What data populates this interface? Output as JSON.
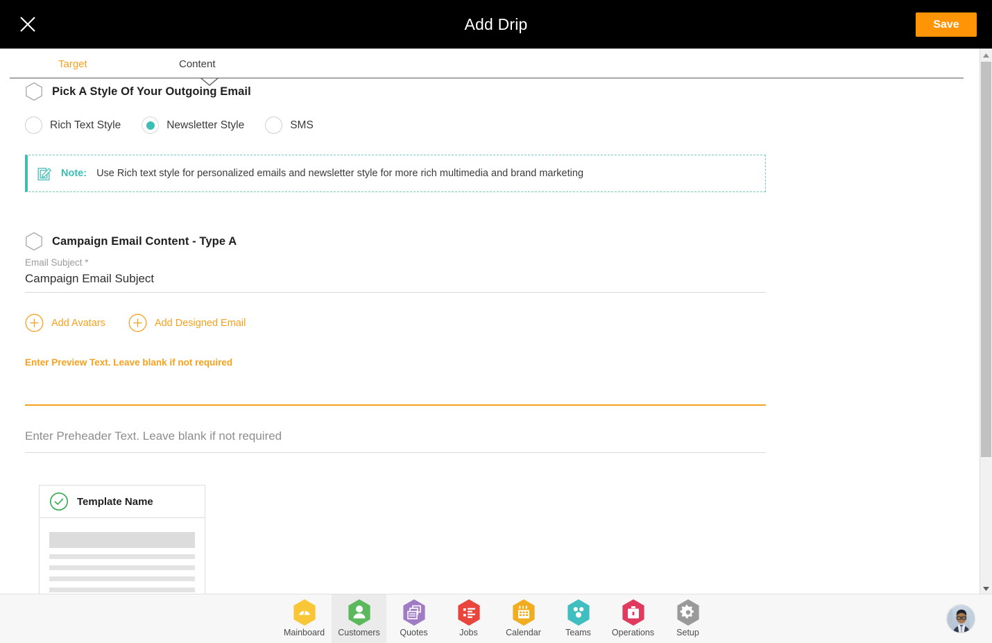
{
  "header": {
    "title": "Add Drip",
    "close_icon": "close-x-icon",
    "save_label": "Save",
    "save_color": "#FF9406"
  },
  "tabs": [
    {
      "label": "Target",
      "active": false,
      "color": "#F5A11E"
    },
    {
      "label": "Content",
      "active": true,
      "color": "#3d3d3d"
    }
  ],
  "sections": {
    "style": {
      "title": "Pick A Style Of Your Outgoing Email",
      "marker_icon": "hexagon-outline-icon",
      "options": [
        {
          "label": "Rich Text Style",
          "selected": false
        },
        {
          "label": "Newsletter Style",
          "selected": true
        },
        {
          "label": "SMS",
          "selected": false
        }
      ],
      "selected_color": "#3BBFB4"
    },
    "note": {
      "icon": "edit-pencil-icon",
      "label": "Note:",
      "text": "Use Rich text style for personalized emails and newsletter style for more rich multimedia and brand marketing",
      "accent_color": "#3BBFB4"
    },
    "campaign": {
      "title": "Campaign Email Content - Type A",
      "marker_icon": "hexagon-outline-icon",
      "email_subject": {
        "label": "Email Subject *",
        "value": "Campaign Email Subject",
        "placeholder": "Email Subject"
      },
      "actions": [
        {
          "label": "Add Avatars",
          "icon": "plus-circle-icon"
        },
        {
          "label": "Add Designed Email",
          "icon": "plus-circle-icon"
        }
      ],
      "preview_text": {
        "label": "Enter Preview Text. Leave blank if not required",
        "value": "",
        "focused": true
      },
      "preheader_text": {
        "placeholder": "Enter Preheader Text. Leave blank if not required",
        "value": "",
        "focused": false
      }
    },
    "template": {
      "name": "Template Name",
      "check_icon": "check-circle-icon",
      "check_color": "#34A853"
    }
  },
  "scrollbar": {
    "up_icon": "caret-up-icon",
    "down_icon": "caret-down-icon"
  },
  "bottom_nav": {
    "items": [
      {
        "label": "Mainboard",
        "icon": "dashboard-gauge-icon",
        "color": "#F8C636",
        "active": false
      },
      {
        "label": "Customers",
        "icon": "person-icon",
        "color": "#5CB85C",
        "active": true
      },
      {
        "label": "Quotes",
        "icon": "stacked-cards-icon",
        "color": "#A07CC5",
        "active": false
      },
      {
        "label": "Jobs",
        "icon": "bulleted-list-icon",
        "color": "#E8453C",
        "active": false
      },
      {
        "label": "Calendar",
        "icon": "calendar-icon",
        "color": "#F0AD20",
        "active": false
      },
      {
        "label": "Teams",
        "icon": "people-dots-icon",
        "color": "#41BFC0",
        "active": false
      },
      {
        "label": "Operations",
        "icon": "briefcase-icon",
        "color": "#E03A5F",
        "active": false
      },
      {
        "label": "Setup",
        "icon": "gear-icon",
        "color": "#9A9A9A",
        "active": false
      }
    ],
    "avatar_icon": "user-avatar-photo"
  }
}
